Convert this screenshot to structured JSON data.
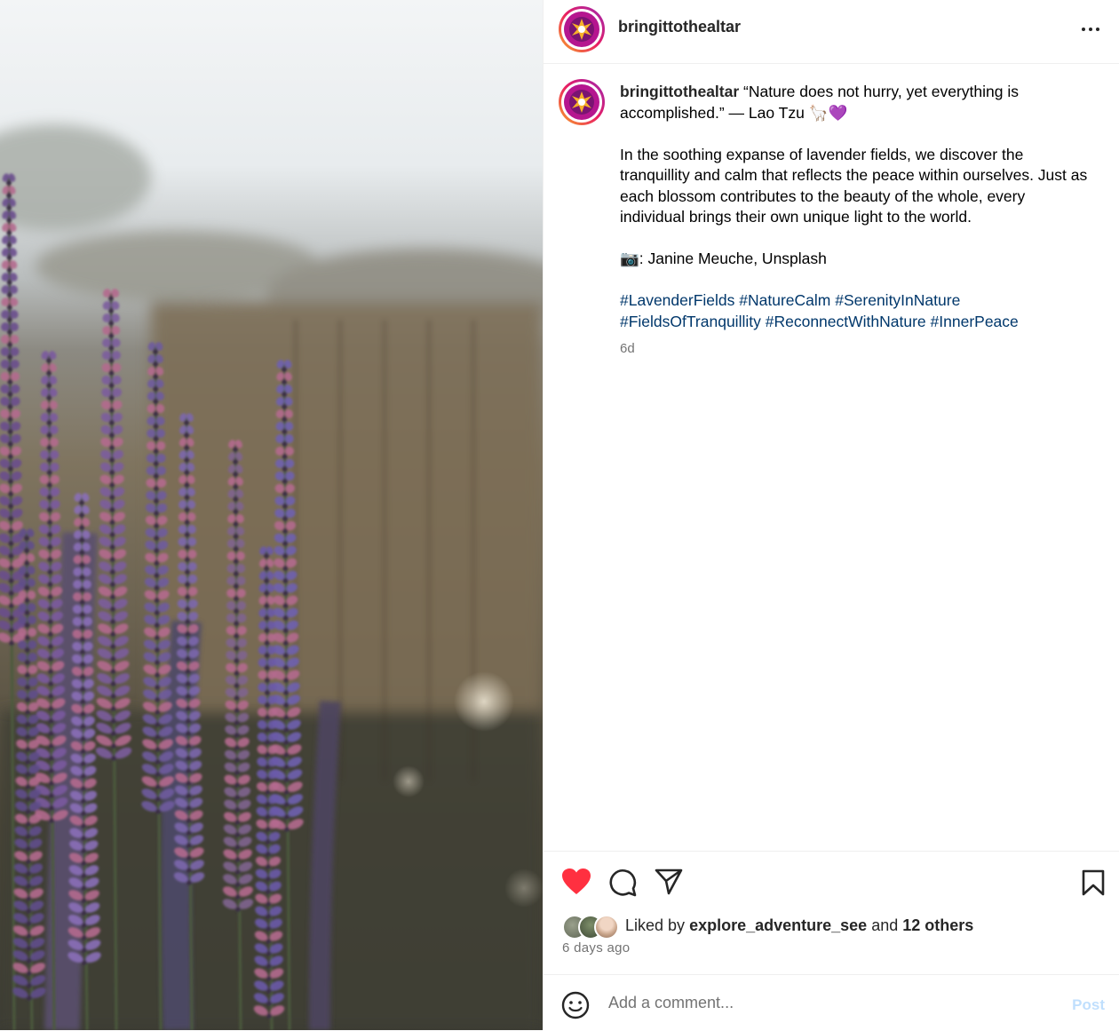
{
  "post": {
    "username": "bringittothealtar",
    "menu_icon": "more-horizontal-icon"
  },
  "caption": {
    "username": "bringittothealtar",
    "line1": "“Nature does not hurry, yet everything is accomplished.” — Lao Tzu 🦙💜",
    "para2": "In the soothing expanse of lavender fields, we discover the tranquillity and calm that reflects the peace within ourselves. Just as each blossom contributes to the beauty of the whole, every individual brings their own unique light to the world.",
    "credit": "📷: Janine Meuche, Unsplash",
    "hashtags": [
      "#LavenderFields",
      "#NatureCalm",
      "#SerenityInNature",
      "#FieldsOfTranquillity",
      "#ReconnectWithNature",
      "#InnerPeace"
    ],
    "time": "6d"
  },
  "actions": {
    "liked": true,
    "like_color": "#ff3040",
    "icons": [
      "heart-icon",
      "comment-icon",
      "share-icon",
      "bookmark-icon"
    ]
  },
  "likes": {
    "prefix": "Liked by",
    "user": "explore_adventure_see",
    "middle": "and",
    "others": "12 others",
    "time": "6 days ago"
  },
  "comment": {
    "placeholder": "Add a comment...",
    "post_label": "Post",
    "emoji_icon": "smiley-icon"
  },
  "colors": {
    "hashtag": "#00376b",
    "muted": "#737373",
    "post_button_disabled": "#c0dffd"
  }
}
